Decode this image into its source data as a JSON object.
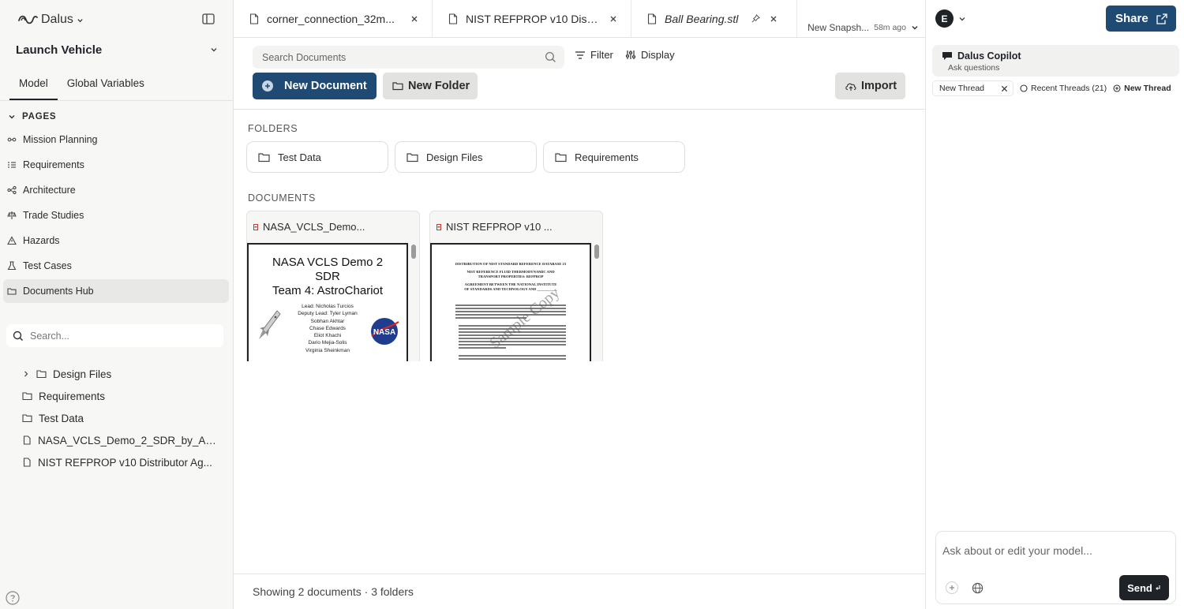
{
  "brand": {
    "name": "Dalus"
  },
  "project": {
    "name": "Launch Vehicle"
  },
  "sidebar": {
    "tabs": [
      {
        "label": "Model",
        "active": true
      },
      {
        "label": "Global Variables",
        "active": false
      }
    ],
    "pages_header": "PAGES",
    "pages": [
      {
        "label": "Mission Planning",
        "icon": "route-icon"
      },
      {
        "label": "Requirements",
        "icon": "list-icon"
      },
      {
        "label": "Architecture",
        "icon": "network-icon"
      },
      {
        "label": "Trade Studies",
        "icon": "scale-icon"
      },
      {
        "label": "Hazards",
        "icon": "warning-icon"
      },
      {
        "label": "Test Cases",
        "icon": "flask-icon"
      },
      {
        "label": "Documents Hub",
        "icon": "folder-icon",
        "active": true
      }
    ],
    "search_placeholder": "Search...",
    "tree": [
      {
        "label": "Design Files",
        "type": "folder",
        "expandable": true
      },
      {
        "label": "Requirements",
        "type": "folder"
      },
      {
        "label": "Test Data",
        "type": "folder"
      },
      {
        "label": "NASA_VCLS_Demo_2_SDR_by_As...",
        "type": "document"
      },
      {
        "label": "NIST REFPROP v10 Distributor Ag...",
        "type": "document"
      }
    ]
  },
  "tabs": [
    {
      "label": "corner_connection_32m...",
      "italic": false
    },
    {
      "label": "NIST REFPROP v10 Distr...",
      "italic": false
    },
    {
      "label": "Ball Bearing.stl",
      "italic": true,
      "pinned": true
    }
  ],
  "snapshot": {
    "label": "New Snapsh...",
    "time": "58m ago"
  },
  "toolbar": {
    "search_placeholder": "Search Documents",
    "filter_label": "Filter",
    "display_label": "Display",
    "new_document_label": "New Document",
    "new_folder_label": "New Folder",
    "import_label": "Import"
  },
  "folders_title": "FOLDERS",
  "folders": [
    "Test Data",
    "Design Files",
    "Requirements"
  ],
  "documents_title": "DOCUMENTS",
  "documents": [
    {
      "name": "NASA_VCLS_Demo...",
      "preview": {
        "title_lines": [
          "NASA VCLS Demo 2",
          "SDR",
          "Team 4: AstroChariot"
        ],
        "people": [
          "Lead: Nicholas Turcios",
          "Deputy Lead: Tyler Lyman",
          "Sobhan Akhtar",
          "Chase Edwards",
          "Eliot Khachi",
          "Dario Mejia-Solis",
          "Virginia Sheinkman"
        ],
        "logo_text": "NASA"
      }
    },
    {
      "name": "NIST REFPROP v10 ...",
      "preview": {
        "heading_1": "DISTRIBUTION OF NIST STANDARD REFERENCE DATABASE 23",
        "heading_2": "NIST REFERENCE FLUID THERMODYNAMIC AND TRANSPORT PROPERTIES: REFPROP",
        "heading_3": "AGREEMENT BETWEEN THE NATIONAL INSTITUTE OF STANDARDS AND TECHNOLOGY AND ___________",
        "watermark": "Sample Copy"
      }
    }
  ],
  "status": "Showing 2 documents · 3 folders",
  "copilot": {
    "avatar_initial": "E",
    "share_label": "Share",
    "title": "Dalus Copilot",
    "subtitle": "Ask questions",
    "thread_chip": "New Thread",
    "recent_threads": "Recent Threads (21)",
    "new_thread_link": "New Thread",
    "ask_placeholder": "Ask about or edit your model...",
    "send_label": "Send"
  },
  "colors": {
    "primary": "#1f4a73",
    "sidebar_bg": "#f7f7f6",
    "active_item": "#e8e8e6",
    "dark": "#1f2328"
  }
}
